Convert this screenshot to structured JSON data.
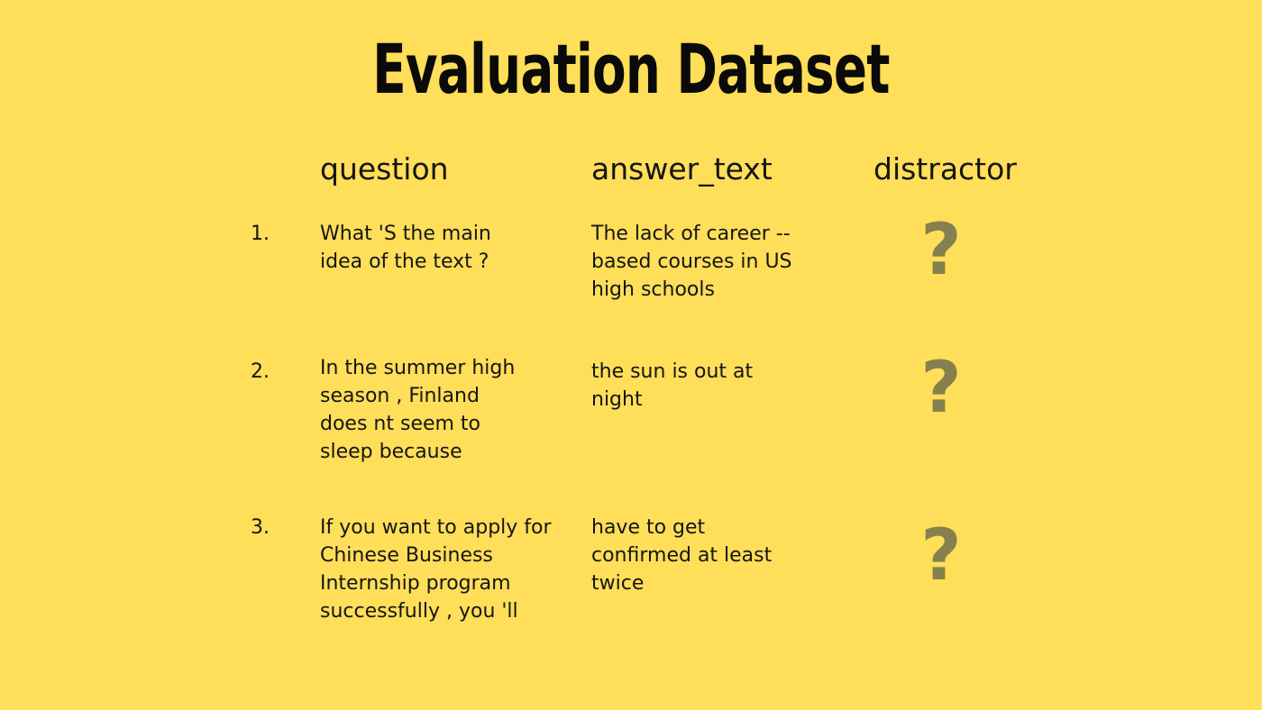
{
  "title": "Evaluation Dataset",
  "columns": {
    "question": "question",
    "answer_text": "answer_text",
    "distractor": "distractor"
  },
  "rows": [
    {
      "number": "1.",
      "question": "What 'S the main\nidea of the text ?",
      "answer_text": "The lack of career --\nbased courses in US\nhigh schools",
      "distractor": "?"
    },
    {
      "number": "2.",
      "question": "In the summer high\nseason , Finland\ndoes nt seem to\nsleep because",
      "answer_text": "the sun is out at\nnight",
      "distractor": "?"
    },
    {
      "number": "3.",
      "question": "If you want to apply for\nChinese Business\nInternship program\nsuccessfully , you 'll",
      "answer_text": "have to get\nconfirmed at least\ntwice",
      "distractor": "?"
    }
  ],
  "colors": {
    "background": "#FFDE59",
    "text": "#111111",
    "question_mark": "#85804F"
  },
  "icons": {
    "distractor_placeholder": "question-mark-icon"
  }
}
